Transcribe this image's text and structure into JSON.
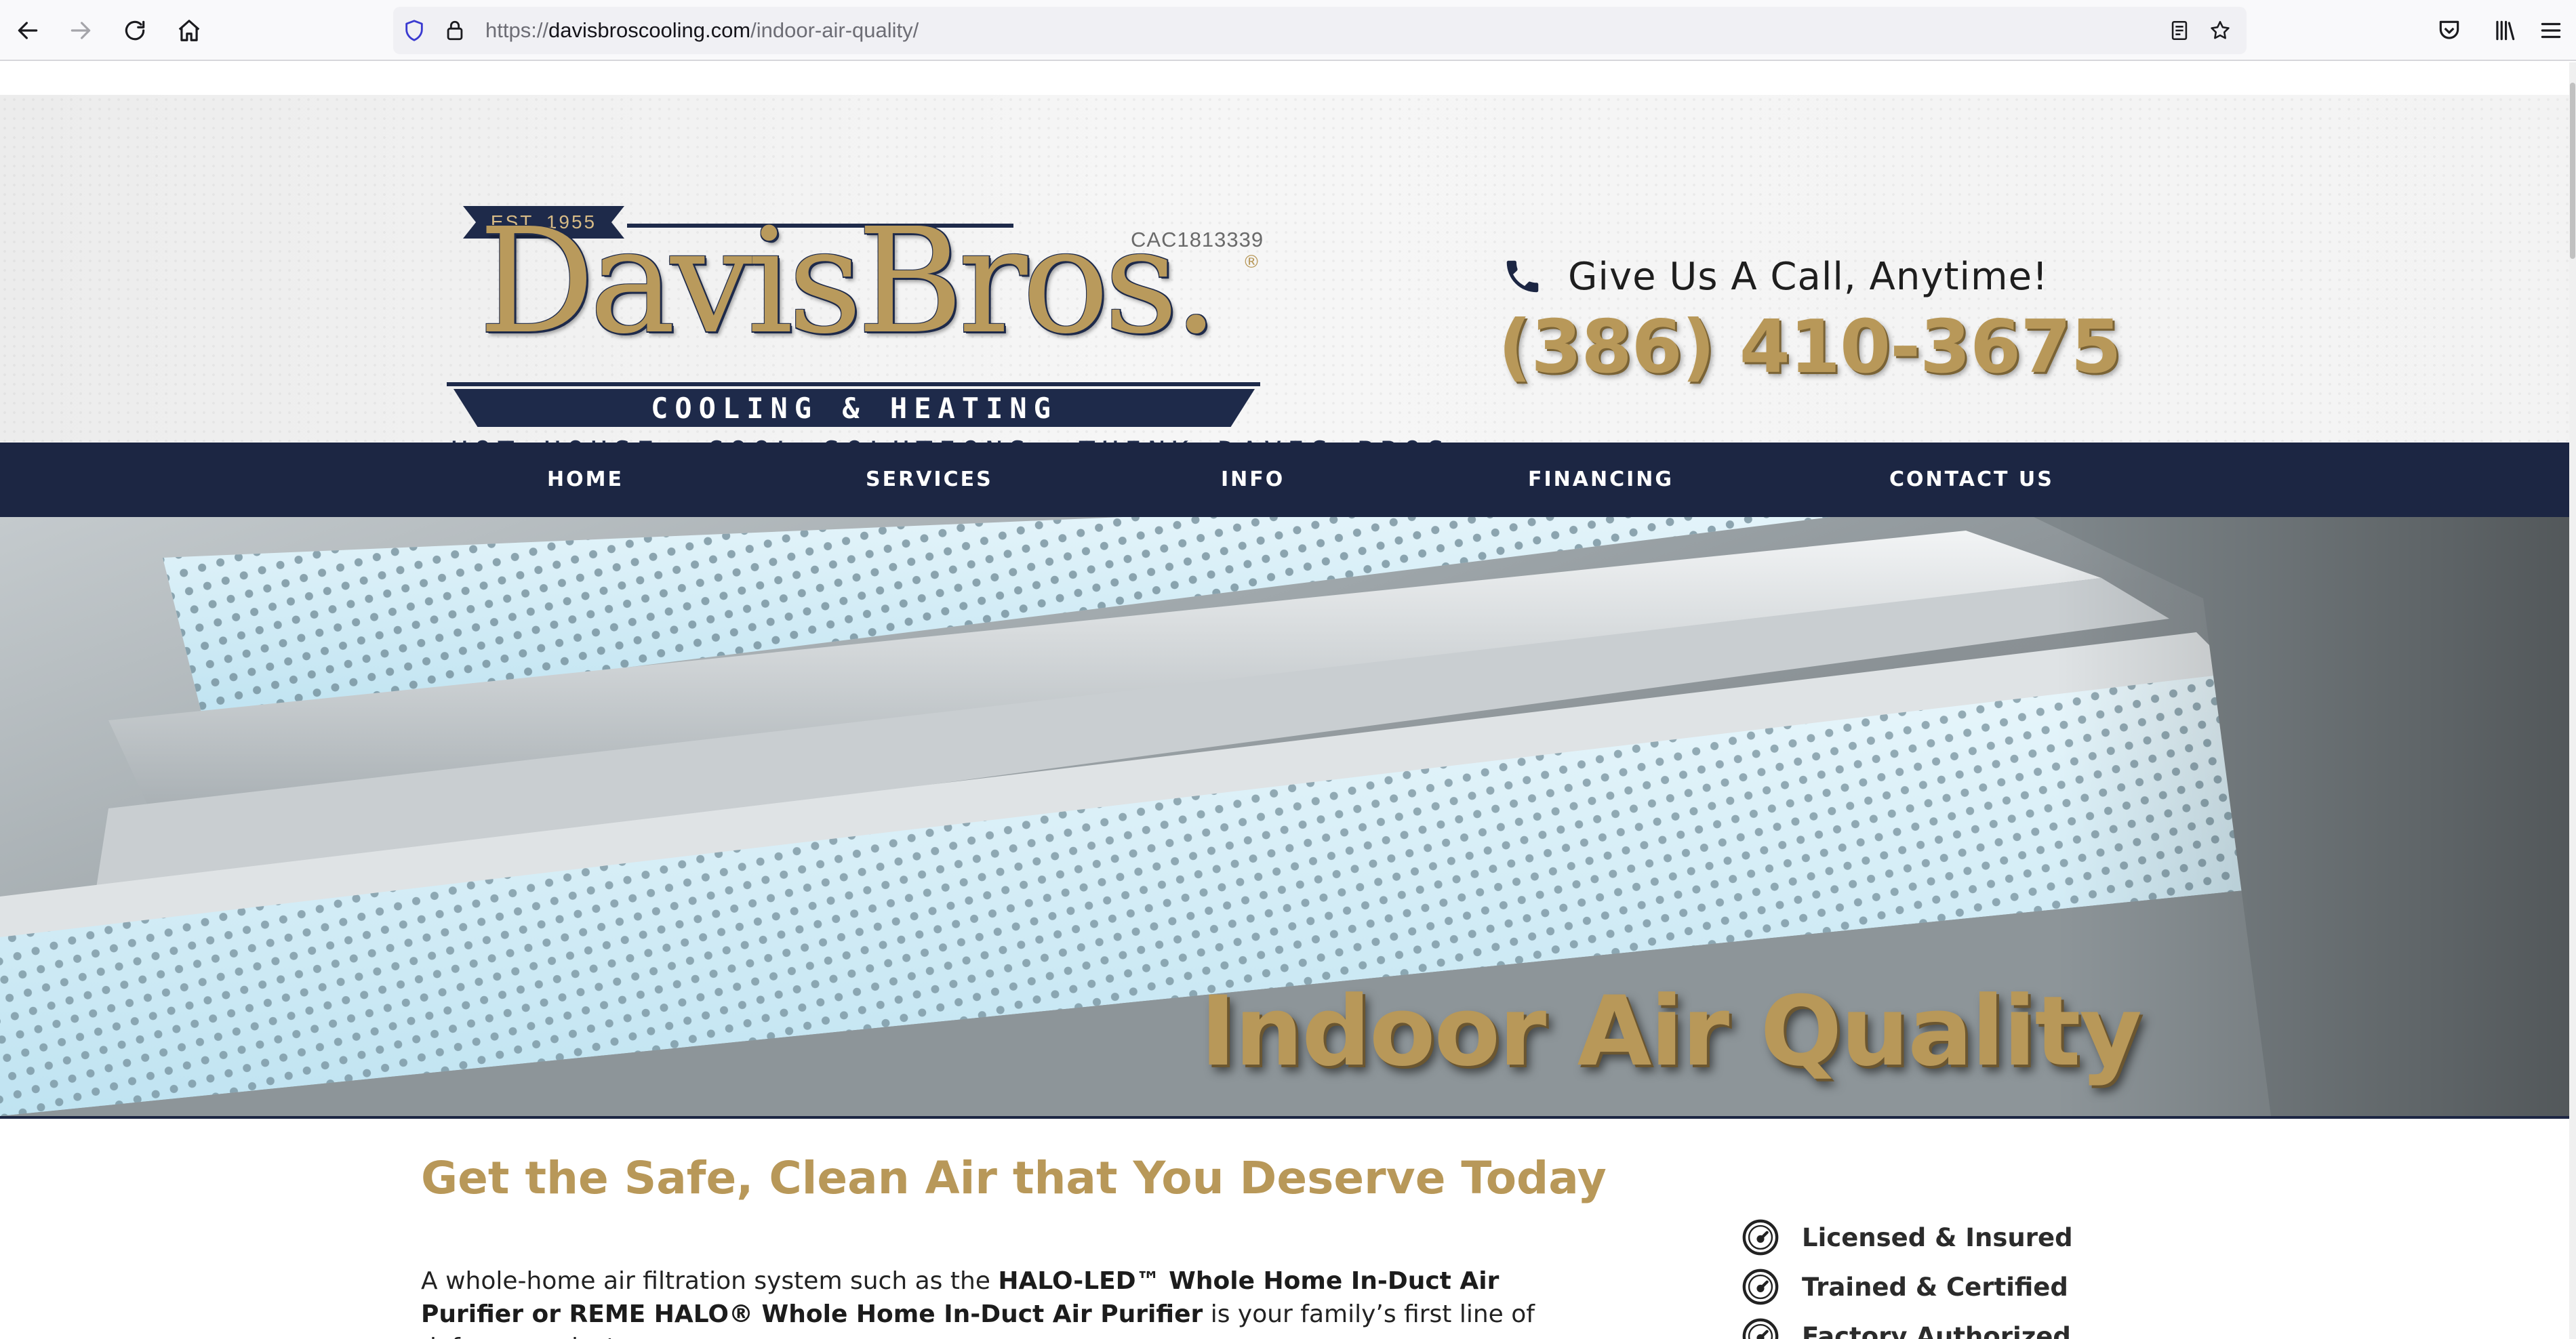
{
  "browser": {
    "url_prefix": "https://",
    "url_host": "davisbroscooling.com",
    "url_path": "/indoor-air-quality/",
    "icons": [
      "back-icon",
      "forward-icon",
      "reload-icon",
      "home-icon",
      "shield-icon",
      "lock-icon",
      "reader-view-icon",
      "bookmark-star-icon",
      "pocket-icon",
      "library-icon",
      "menu-icon"
    ]
  },
  "header": {
    "license": "CAC1813339",
    "logo": {
      "est": "EST. 1955",
      "name": "DavisBros.",
      "reg": "®",
      "band": "COOLING & HEATING",
      "tagline": "HOT HOUSE. COOL SOLUTIONS. THINK DAVIS BROS."
    },
    "call_label": "Give Us A Call, Anytime!",
    "phone": "(386) 410-3675"
  },
  "nav": {
    "items": [
      {
        "label": "HOME"
      },
      {
        "label": "SERVICES"
      },
      {
        "label": "INFO"
      },
      {
        "label": "FINANCING"
      },
      {
        "label": "CONTACT US"
      }
    ]
  },
  "hero": {
    "title": "Indoor Air Quality"
  },
  "content": {
    "heading": "Get the Safe, Clean Air that You Deserve Today",
    "body_intro": "A whole-home air filtration system such as the ",
    "body_bold_1": "HALO-LED™ Whole Home In-Duct Air Purifier or REME HALO® Whole Home In-Duct Air Purifier",
    "body_rest": " is your family’s first line of defense against"
  },
  "badges": {
    "items": [
      {
        "label": "Licensed & Insured"
      },
      {
        "label": "Trained & Certified"
      },
      {
        "label": "Factory Authorized"
      }
    ]
  },
  "colors": {
    "navy": "#1c2643",
    "gold": "#b89859",
    "text": "#222222"
  }
}
